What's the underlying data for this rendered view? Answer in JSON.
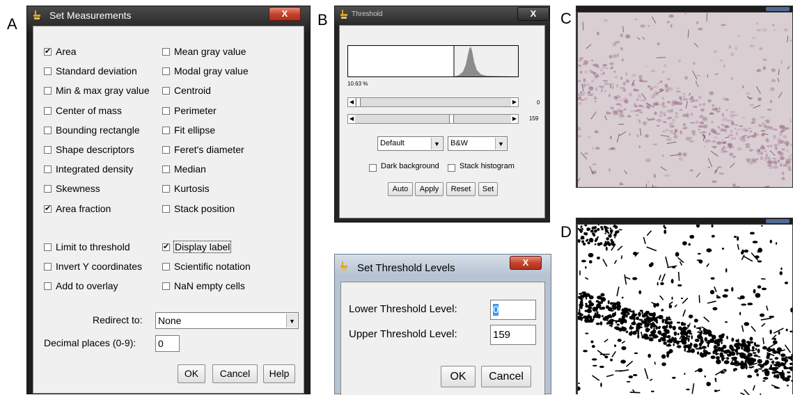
{
  "panels": {
    "a": "A",
    "b": "B",
    "c": "C",
    "d": "D"
  },
  "set_measurements": {
    "title": "Set Measurements",
    "close": "X",
    "left_column": [
      {
        "label": "Area",
        "checked": true
      },
      {
        "label": "Standard deviation",
        "checked": false
      },
      {
        "label": "Min & max gray value",
        "checked": false
      },
      {
        "label": "Center of mass",
        "checked": false
      },
      {
        "label": "Bounding rectangle",
        "checked": false
      },
      {
        "label": "Shape descriptors",
        "checked": false
      },
      {
        "label": "Integrated density",
        "checked": false
      },
      {
        "label": "Skewness",
        "checked": false
      },
      {
        "label": "Area fraction",
        "checked": true
      }
    ],
    "right_column": [
      {
        "label": "Mean gray value",
        "checked": false
      },
      {
        "label": "Modal gray value",
        "checked": false
      },
      {
        "label": "Centroid",
        "checked": false
      },
      {
        "label": "Perimeter",
        "checked": false
      },
      {
        "label": "Fit ellipse",
        "checked": false
      },
      {
        "label": "Feret's diameter",
        "checked": false
      },
      {
        "label": "Median",
        "checked": false
      },
      {
        "label": "Kurtosis",
        "checked": false
      },
      {
        "label": "Stack position",
        "checked": false
      }
    ],
    "options_left": [
      {
        "label": "Limit to threshold",
        "checked": false
      },
      {
        "label": "Invert Y coordinates",
        "checked": false
      },
      {
        "label": "Add to overlay",
        "checked": false
      }
    ],
    "options_right": [
      {
        "label": "Display label",
        "checked": true
      },
      {
        "label": "Scientific notation",
        "checked": false
      },
      {
        "label": "NaN empty cells",
        "checked": false
      }
    ],
    "redirect_label": "Redirect to:",
    "redirect_value": "None",
    "decimal_label": "Decimal places (0-9):",
    "decimal_value": "0",
    "ok": "OK",
    "cancel": "Cancel",
    "help": "Help"
  },
  "threshold": {
    "title": "Threshold",
    "close": "X",
    "percent": "10.63 %",
    "slider1_value": "0",
    "slider2_value": "159",
    "slider2_fraction": 0.62,
    "method": "Default",
    "display": "B&W",
    "dark_background": {
      "label": "Dark background",
      "checked": false
    },
    "stack_histogram": {
      "label": "Stack histogram",
      "checked": false
    },
    "auto": "Auto",
    "apply": "Apply",
    "reset": "Reset",
    "set": "Set"
  },
  "set_threshold_levels": {
    "title": "Set Threshold Levels",
    "close": "X",
    "lower_label": "Lower Threshold Level:",
    "lower_value": "0",
    "upper_label": "Upper Threshold Level:",
    "upper_value": "159",
    "ok": "OK",
    "cancel": "Cancel"
  },
  "image_c": {
    "colors": {
      "tissue": "#d9ced2",
      "stain": "#a37a93",
      "dark": "#3a2430"
    }
  },
  "image_d": {
    "colors": {
      "bg": "#ffffff",
      "mask": "#000000"
    }
  }
}
